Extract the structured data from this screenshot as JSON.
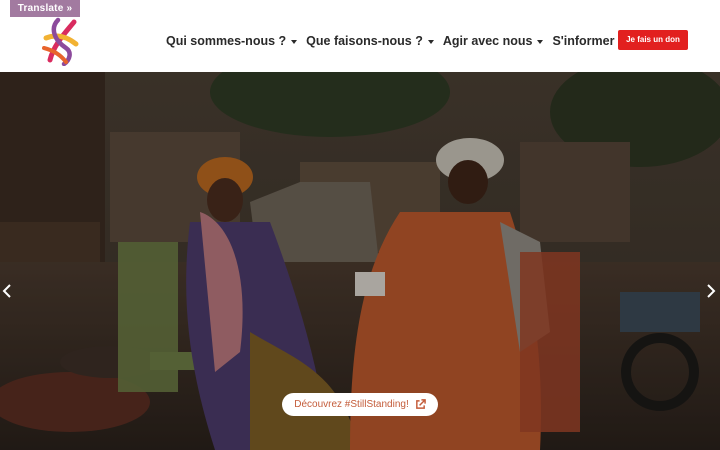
{
  "translate": {
    "label": "Translate »"
  },
  "nav": {
    "items": [
      {
        "label": "Qui sommes-nous ?"
      },
      {
        "label": "Que faisons-nous ?"
      },
      {
        "label": "Agir avec nous"
      },
      {
        "label": "S'informer"
      }
    ]
  },
  "donate": {
    "label": "Je fais un don"
  },
  "hero": {
    "cta_label": "Découvrez #StillStanding!",
    "prev_icon": "chevron-left-icon",
    "next_icon": "chevron-right-icon"
  },
  "colors": {
    "translate_bg": "#a27aa0",
    "donate_bg": "#e2201f",
    "cta_text": "#c45c3a"
  }
}
